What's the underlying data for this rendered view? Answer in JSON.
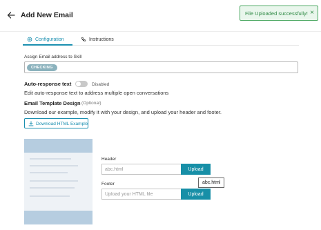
{
  "header": {
    "title": "Add New Email",
    "back_icon": "arrow-left-icon"
  },
  "toast": {
    "message": "File Uploaded successfully!",
    "close_glyph": "×",
    "color": "#2f8a45"
  },
  "tabs": [
    {
      "label": "Configuration",
      "icon": "gear-icon",
      "active": true
    },
    {
      "label": "Instructions",
      "icon": "phone-icon",
      "active": false
    }
  ],
  "skill": {
    "label": "Assign Email address to Skill",
    "chip": "CHECKING"
  },
  "auto_response": {
    "label": "Auto-response text",
    "toggle_state": "Disabled",
    "description": "Edit auto-response text to address multiple open conversations"
  },
  "template": {
    "label": "Email Template Design",
    "optional": "(Optional)",
    "description": "Download our example, modify it with your design, and upload your header and footer.",
    "download_button": "Download HTML Example",
    "download_icon": "download-icon"
  },
  "upload_header": {
    "label": "Header",
    "value": "abc.html",
    "button": "Upload",
    "tooltip": "abc.html"
  },
  "upload_footer": {
    "label": "Footer",
    "placeholder": "Upload your HTML file",
    "button": "Upload"
  },
  "colors": {
    "accent": "#1a8fb0",
    "upload_button": "#178fa7",
    "chip": "#8bb2bd",
    "preview_band": "#b6cde0"
  }
}
